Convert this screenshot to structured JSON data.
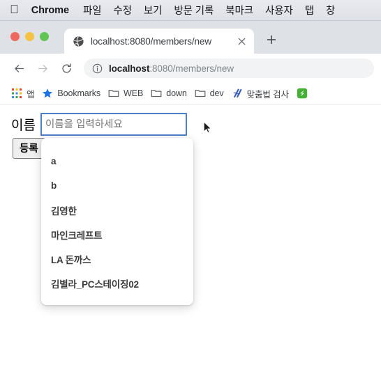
{
  "menubar": {
    "apple_glyph": "",
    "items": [
      {
        "label": "Chrome",
        "name": "menu-chrome",
        "bold": true
      },
      {
        "label": "파일",
        "name": "menu-file"
      },
      {
        "label": "수정",
        "name": "menu-edit"
      },
      {
        "label": "보기",
        "name": "menu-view"
      },
      {
        "label": "방문 기록",
        "name": "menu-history"
      },
      {
        "label": "북마크",
        "name": "menu-bookmarks"
      },
      {
        "label": "사용자",
        "name": "menu-profiles"
      },
      {
        "label": "탭",
        "name": "menu-tab"
      },
      {
        "label": "창",
        "name": "menu-window"
      }
    ]
  },
  "browser": {
    "tab": {
      "title": "localhost:8080/members/new",
      "favicon": "globe-icon",
      "close": "×"
    },
    "new_tab_label": "+",
    "toolbar": {
      "back": "←",
      "forward": "→",
      "reload": "↻",
      "omnibox": {
        "host": "localhost",
        "path": ":8080/members/new",
        "full": "localhost:8080/members/new",
        "security_icon": "info-circle-icon"
      }
    },
    "bookmarks": [
      {
        "label": "앱",
        "icon": "apps-grid-icon",
        "name": "bookmark-apps"
      },
      {
        "label": "Bookmarks",
        "icon": "star-icon",
        "name": "bookmark-bookmarks"
      },
      {
        "label": "WEB",
        "icon": "folder-icon",
        "name": "bookmark-web"
      },
      {
        "label": "down",
        "icon": "folder-icon",
        "name": "bookmark-down"
      },
      {
        "label": "dev",
        "icon": "folder-icon",
        "name": "bookmark-dev"
      },
      {
        "label": "맞춤법 검사",
        "icon": "spellcheck-icon",
        "name": "bookmark-spellcheck"
      },
      {
        "label": "",
        "icon": "evernote-icon",
        "name": "bookmark-evernote"
      }
    ]
  },
  "page": {
    "form": {
      "name_label": "이름",
      "name_placeholder": "이름을 입력하세요",
      "name_value": "",
      "submit_label": "등록"
    },
    "autofill": {
      "items": [
        "a",
        "b",
        "김영한",
        "마인크레프트",
        "LA 돈까스",
        "김별라_PC스테이징02"
      ]
    }
  },
  "colors": {
    "focus_ring": "#4a7ec9",
    "traffic_red": "#ee6a5f",
    "traffic_yellow": "#f5c243",
    "traffic_green": "#61c554",
    "bookmark_star": "#1a73e8",
    "chrome_bg": "#dee1e6"
  }
}
